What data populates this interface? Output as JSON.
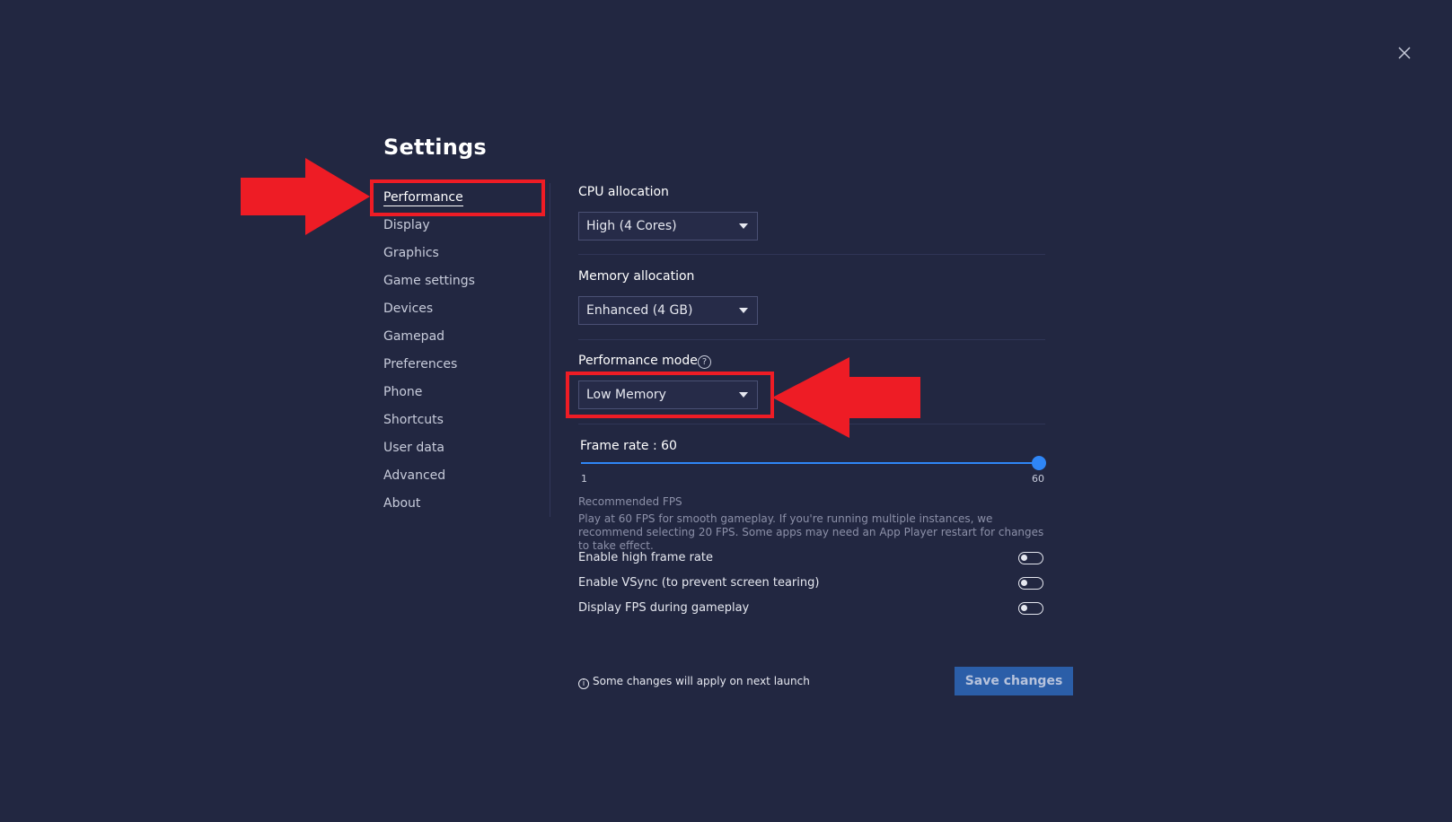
{
  "colors": {
    "background": "#222741",
    "accent": "#2f86f6",
    "annotation": "#ee1c25",
    "save_button": "#2b5ea8"
  },
  "window": {
    "title": "Settings",
    "close_icon": "close-icon"
  },
  "sidebar": {
    "items": [
      {
        "label": "Performance",
        "active": true
      },
      {
        "label": "Display"
      },
      {
        "label": "Graphics"
      },
      {
        "label": "Game settings"
      },
      {
        "label": "Devices"
      },
      {
        "label": "Gamepad"
      },
      {
        "label": "Preferences"
      },
      {
        "label": "Phone"
      },
      {
        "label": "Shortcuts"
      },
      {
        "label": "User data"
      },
      {
        "label": "Advanced"
      },
      {
        "label": "About"
      }
    ]
  },
  "performance": {
    "cpu_label": "CPU allocation",
    "cpu_value": "High (4 Cores)",
    "memory_label": "Memory allocation",
    "memory_value": "Enhanced (4 GB)",
    "mode_label": "Performance mode",
    "mode_help": "?",
    "mode_value": "Low Memory",
    "frame_rate_label": "Frame rate : 60",
    "frame_rate_min": "1",
    "frame_rate_max": "60",
    "frame_rate_value": 60,
    "recommended_title": "Recommended FPS",
    "recommended_text": "Play at 60 FPS for smooth gameplay. If you're running multiple instances, we recommend selecting 20 FPS. Some apps may need an App Player restart for changes to take effect.",
    "toggles": [
      {
        "label": "Enable high frame rate",
        "on": false
      },
      {
        "label": "Enable VSync (to prevent screen tearing)",
        "on": false
      },
      {
        "label": "Display FPS during gameplay",
        "on": false
      }
    ]
  },
  "footer": {
    "note": "Some changes will apply on next launch",
    "info_icon": "i",
    "save_label": "Save changes"
  }
}
